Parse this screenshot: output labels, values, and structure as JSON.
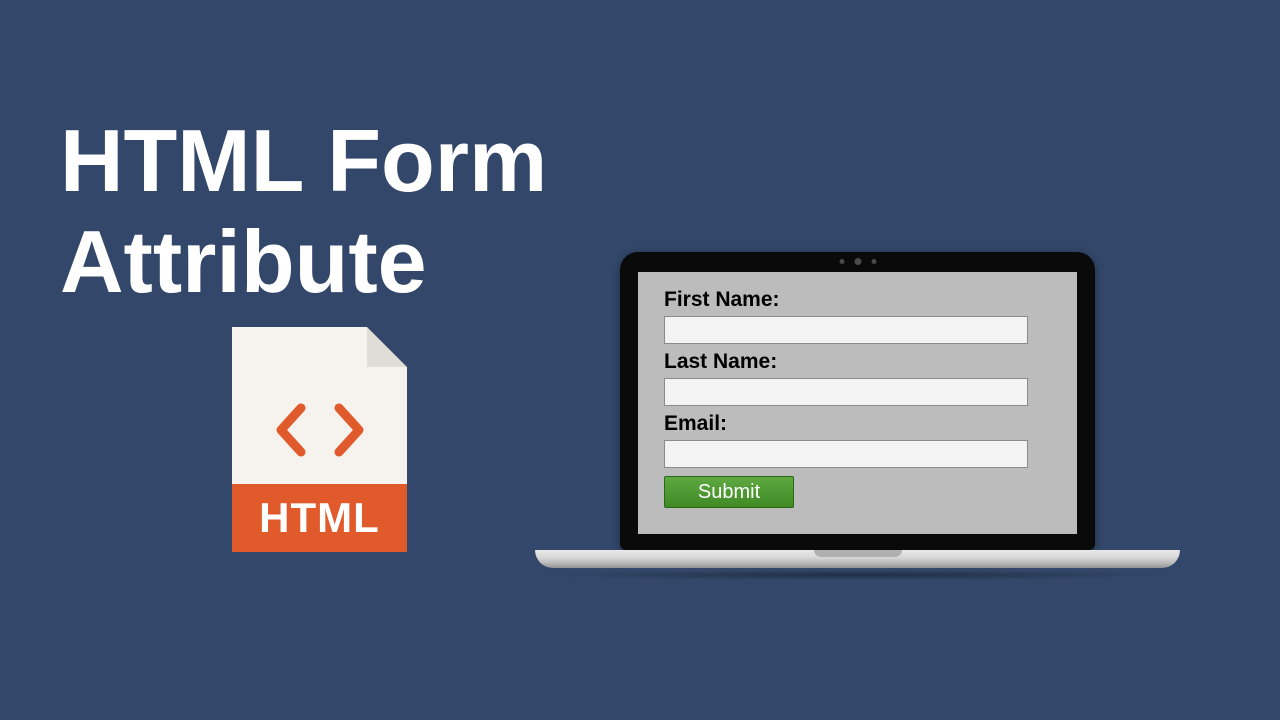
{
  "title_line1": "HTML Form",
  "title_line2": "Attribute",
  "file_label": "HTML",
  "form": {
    "first_name_label": "First Name:",
    "last_name_label": "Last Name:",
    "email_label": "Email:",
    "submit_label": "Submit"
  }
}
